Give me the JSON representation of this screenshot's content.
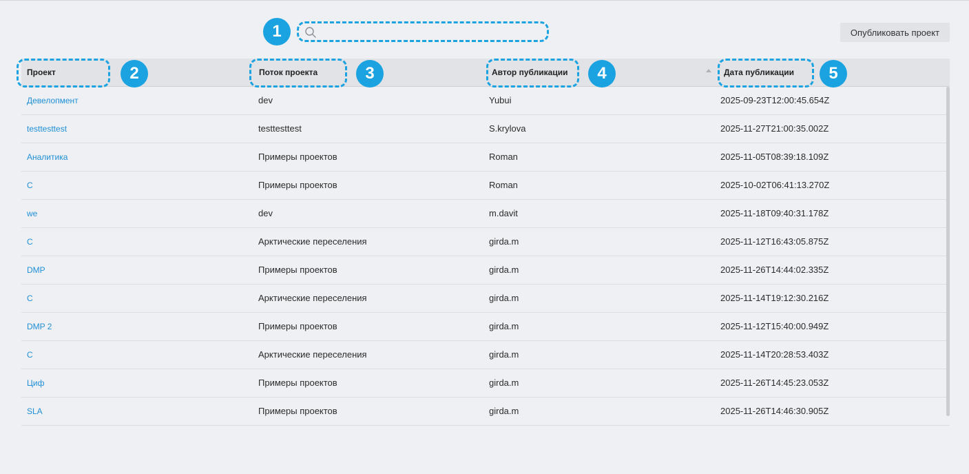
{
  "search": {
    "value": "",
    "placeholder": ""
  },
  "toolbar": {
    "publish_label": "Опубликовать проект"
  },
  "badges": [
    "1",
    "2",
    "3",
    "4",
    "5"
  ],
  "table": {
    "columns": [
      "Проект",
      "Поток проекта",
      "Автор публикации",
      "Дата публикации"
    ],
    "rows": [
      {
        "project": "Девелопмент",
        "stream": "dev",
        "author": "Yubui",
        "date": "2025-09-23T12:00:45.654Z"
      },
      {
        "project": "testtesttest",
        "stream": "testtesttest",
        "author": "S.krylova",
        "date": "2025-11-27T21:00:35.002Z"
      },
      {
        "project": "Аналитика",
        "stream": "Примеры проектов",
        "author": "Roman",
        "date": "2025-11-05T08:39:18.109Z"
      },
      {
        "project": "C",
        "stream": "Примеры проектов",
        "author": "Roman",
        "date": "2025-10-02T06:41:13.270Z"
      },
      {
        "project": "we",
        "stream": "dev",
        "author": "m.davit",
        "date": "2025-11-18T09:40:31.178Z"
      },
      {
        "project": "C",
        "stream": "Арктические переселения",
        "author": "girda.m",
        "date": "2025-11-12T16:43:05.875Z"
      },
      {
        "project": "DMP",
        "stream": "Примеры проектов",
        "author": "girda.m",
        "date": "2025-11-26T14:44:02.335Z"
      },
      {
        "project": "C",
        "stream": "Арктические переселения",
        "author": "girda.m",
        "date": "2025-11-14T19:12:30.216Z"
      },
      {
        "project": "DMP 2",
        "stream": "Примеры проектов",
        "author": "girda.m",
        "date": "2025-11-12T15:40:00.949Z"
      },
      {
        "project": "C",
        "stream": "Арктические переселения",
        "author": "girda.m",
        "date": "2025-11-14T20:28:53.403Z"
      },
      {
        "project": "Циф",
        "stream": "Примеры проектов",
        "author": "girda.m",
        "date": "2025-11-26T14:45:23.053Z"
      },
      {
        "project": "SLA",
        "stream": "Примеры проектов",
        "author": "girda.m",
        "date": "2025-11-26T14:46:30.905Z"
      }
    ]
  },
  "colors": {
    "accent": "#1aa3e0",
    "link": "#1f8fd6",
    "background": "#eef0f3",
    "header_bg": "#e1e3e7"
  },
  "icons": {
    "search": "search-icon",
    "sort": "sort-asc-icon"
  }
}
